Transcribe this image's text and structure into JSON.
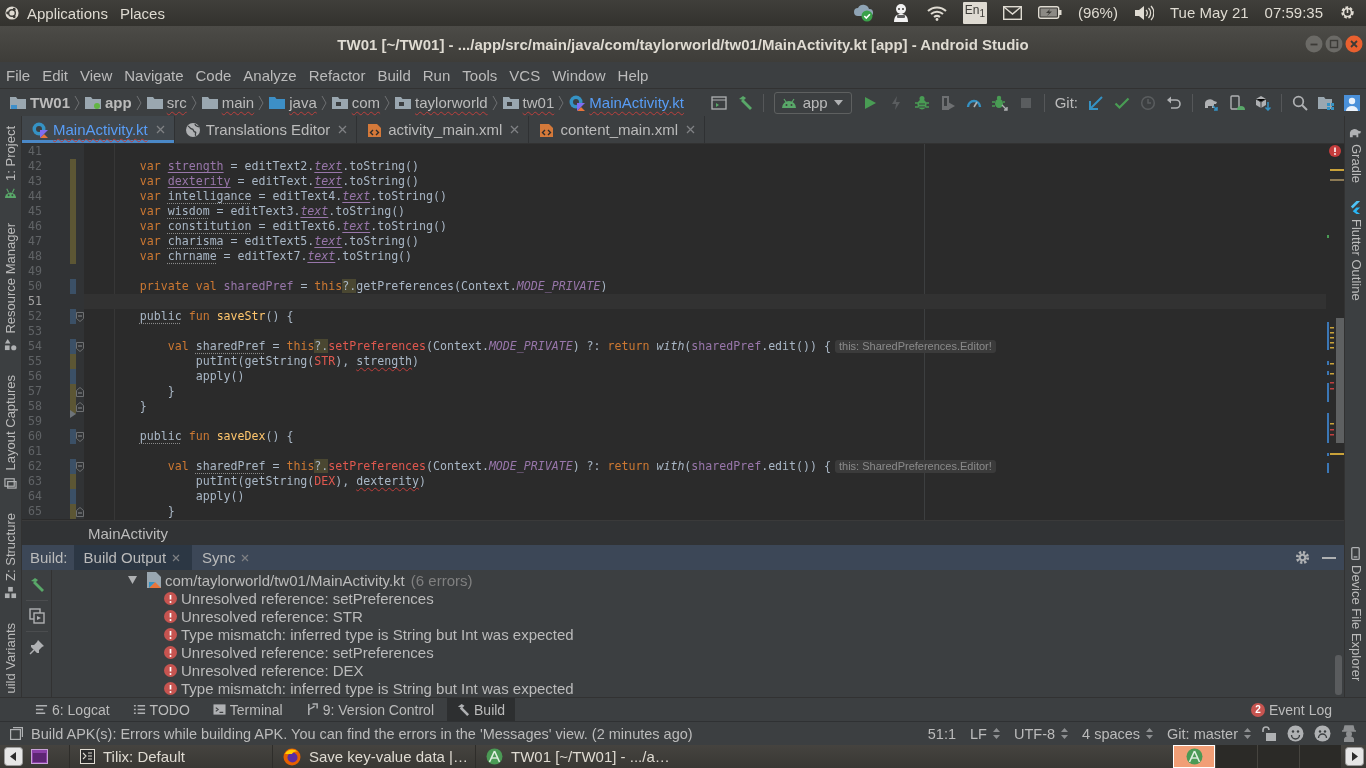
{
  "top_panel": {
    "menus": [
      "Applications",
      "Places"
    ],
    "keyboard_layout": "En$_{1}$",
    "battery": "(96%)",
    "date": "Tue May 21",
    "time": "07:59:35"
  },
  "window": {
    "title": "TW01 [~/TW01] - .../app/src/main/java/com/taylorworld/tw01/MainActivity.kt [app] - Android Studio"
  },
  "menu_bar": [
    "File",
    "Edit",
    "View",
    "Navigate",
    "Code",
    "Analyze",
    "Refactor",
    "Build",
    "Run",
    "Tools",
    "VCS",
    "Window",
    "Help"
  ],
  "nav_bar": {
    "breadcrumbs": [
      {
        "label": "TW01",
        "kind": "project",
        "errors": false,
        "modified": false
      },
      {
        "label": "app",
        "kind": "module",
        "errors": false,
        "modified": false
      },
      {
        "label": "src",
        "kind": "folder",
        "errors": true,
        "modified": false
      },
      {
        "label": "main",
        "kind": "folder",
        "errors": true,
        "modified": false
      },
      {
        "label": "java",
        "kind": "source-root",
        "errors": true,
        "modified": false
      },
      {
        "label": "com",
        "kind": "package",
        "errors": true,
        "modified": false
      },
      {
        "label": "taylorworld",
        "kind": "package",
        "errors": true,
        "modified": false
      },
      {
        "label": "tw01",
        "kind": "package",
        "errors": true,
        "modified": false
      },
      {
        "label": "MainActivity.kt",
        "kind": "kotlin-file",
        "errors": true,
        "modified": true
      }
    ],
    "run_config": "app",
    "apply_changes_disabled": true,
    "stop_disabled": true,
    "history_disabled": true,
    "git_label": "Git:"
  },
  "left_tool_strip": [
    {
      "label": "1: Project",
      "kind": "project"
    },
    {
      "label": "Resource Manager",
      "kind": "resources"
    },
    {
      "label": "Layout Captures",
      "kind": "captures"
    },
    {
      "label": "Z: Structure",
      "kind": "structure"
    },
    {
      "label": "uild Variants",
      "kind": "variants"
    }
  ],
  "right_tool_strip": {
    "top": [
      {
        "label": "Gradle",
        "kind": "gradle"
      },
      {
        "label": "Flutter Outline",
        "kind": "flutter"
      }
    ],
    "bottom": [
      {
        "label": "Device File Explorer",
        "kind": "device"
      }
    ]
  },
  "editor_tabs": [
    {
      "label": "MainActivity.kt",
      "kind": "kotlin",
      "selected": true,
      "modified": true,
      "errors": true
    },
    {
      "label": "Translations Editor",
      "kind": "translations",
      "selected": false,
      "modified": false,
      "errors": false
    },
    {
      "label": "activity_main.xml",
      "kind": "xml",
      "selected": false,
      "modified": false,
      "errors": false
    },
    {
      "label": "content_main.xml",
      "kind": "xml",
      "selected": false,
      "modified": false,
      "errors": false
    }
  ],
  "editor": {
    "lines": [
      {
        "number": "41",
        "added": false,
        "modified": false,
        "deleted_below": false,
        "fold_start": false,
        "fold_end": false,
        "current": false
      },
      {
        "number": "42",
        "tokens": [
          {
            "kind": "keyword",
            "text": "var "
          },
          {
            "kind": "mutable",
            "text": "strength"
          },
          {
            "kind": "plain",
            "text": " = editText2."
          },
          {
            "kind": "member",
            "text": "text"
          },
          {
            "kind": "plain",
            "text": ".toString()"
          }
        ],
        "added": true,
        "modified": false,
        "deleted_below": false,
        "fold_start": false,
        "fold_end": false,
        "current": false
      },
      {
        "number": "43",
        "tokens": [
          {
            "kind": "keyword",
            "text": "var "
          },
          {
            "kind": "mutable",
            "text": "dexterity"
          },
          {
            "kind": "plain",
            "text": " = editText."
          },
          {
            "kind": "member",
            "text": "text"
          },
          {
            "kind": "plain",
            "text": ".toString()"
          }
        ],
        "added": true,
        "modified": false,
        "deleted_below": false,
        "fold_start": false,
        "fold_end": false,
        "current": false
      },
      {
        "number": "44",
        "tokens": [
          {
            "kind": "keyword",
            "text": "var "
          },
          {
            "kind": "unused",
            "text": "intelligance"
          },
          {
            "kind": "plain",
            "text": " = editText4."
          },
          {
            "kind": "member",
            "text": "text"
          },
          {
            "kind": "plain",
            "text": ".toString()"
          }
        ],
        "added": true,
        "modified": false,
        "deleted_below": false,
        "fold_start": false,
        "fold_end": false,
        "current": false
      },
      {
        "number": "45",
        "tokens": [
          {
            "kind": "keyword",
            "text": "var "
          },
          {
            "kind": "unused",
            "text": "wisdom"
          },
          {
            "kind": "plain",
            "text": " = editText3."
          },
          {
            "kind": "member",
            "text": "text"
          },
          {
            "kind": "plain",
            "text": ".toString()"
          }
        ],
        "added": true,
        "modified": false,
        "deleted_below": false,
        "fold_start": false,
        "fold_end": false,
        "current": false
      },
      {
        "number": "46",
        "tokens": [
          {
            "kind": "keyword",
            "text": "var "
          },
          {
            "kind": "unused",
            "text": "constitution"
          },
          {
            "kind": "plain",
            "text": " = editText6."
          },
          {
            "kind": "member",
            "text": "text"
          },
          {
            "kind": "plain",
            "text": ".toString()"
          }
        ],
        "added": true,
        "modified": false,
        "deleted_below": false,
        "fold_start": false,
        "fold_end": false,
        "current": false
      },
      {
        "number": "47",
        "tokens": [
          {
            "kind": "keyword",
            "text": "var "
          },
          {
            "kind": "unused",
            "text": "charisma"
          },
          {
            "kind": "plain",
            "text": " = editText5."
          },
          {
            "kind": "member",
            "text": "text"
          },
          {
            "kind": "plain",
            "text": ".toString()"
          }
        ],
        "added": true,
        "modified": false,
        "deleted_below": false,
        "fold_start": false,
        "fold_end": false,
        "current": false
      },
      {
        "number": "48",
        "tokens": [
          {
            "kind": "keyword",
            "text": "var "
          },
          {
            "kind": "unused",
            "text": "chrname"
          },
          {
            "kind": "plain",
            "text": " = editText7."
          },
          {
            "kind": "member",
            "text": "text"
          },
          {
            "kind": "plain",
            "text": ".toString()"
          }
        ],
        "added": true,
        "modified": false,
        "deleted_below": false,
        "fold_start": false,
        "fold_end": false,
        "current": false
      },
      {
        "number": "49",
        "added": false,
        "modified": false,
        "deleted_below": false,
        "fold_start": false,
        "fold_end": false,
        "current": false
      },
      {
        "number": "50",
        "tokens": [
          {
            "kind": "keyword",
            "text": "private val "
          },
          {
            "kind": "property",
            "text": "sharedPref"
          },
          {
            "kind": "plain",
            "text": " = "
          },
          {
            "kind": "keyword",
            "text": "this"
          },
          {
            "kind": "nullsafe",
            "text": "?."
          },
          {
            "kind": "plain",
            "text": "getPreferences(Context."
          },
          {
            "kind": "constant",
            "text": "MODE_PRIVATE"
          },
          {
            "kind": "plain",
            "text": ")"
          }
        ],
        "added": false,
        "modified": true,
        "deleted_below": false,
        "fold_start": false,
        "fold_end": false,
        "current": false
      },
      {
        "number": "51",
        "added": false,
        "modified": false,
        "deleted_below": false,
        "fold_start": false,
        "fold_end": false,
        "current": true
      },
      {
        "number": "52",
        "tokens": [
          {
            "kind": "unused",
            "text": "public"
          },
          {
            "kind": "keyword",
            "text": " fun "
          },
          {
            "kind": "function",
            "text": "saveStr"
          },
          {
            "kind": "plain",
            "text": "() {"
          }
        ],
        "added": false,
        "modified": true,
        "deleted_below": false,
        "fold_start": true,
        "fold_end": false,
        "current": false,
        "children": [
          {
            "number": "53",
            "added": false,
            "modified": false,
            "deleted_below": false,
            "fold_start": false,
            "fold_end": false,
            "current": false
          },
          {
            "number": "54",
            "tokens": [
              {
                "kind": "keyword",
                "text": "val "
              },
              {
                "kind": "unused",
                "text": "sharedPref"
              },
              {
                "kind": "plain",
                "text": " = "
              },
              {
                "kind": "keyword",
                "text": "this"
              },
              {
                "kind": "nullsafe",
                "text": "?."
              },
              {
                "kind": "unresolved",
                "text": "setPreferences"
              },
              {
                "kind": "plain",
                "text": "(Context."
              },
              {
                "kind": "constant",
                "text": "MODE_PRIVATE"
              },
              {
                "kind": "plain",
                "text": ") ?: "
              },
              {
                "kind": "keyword",
                "text": "return "
              },
              {
                "kind": "scope",
                "text": "with"
              },
              {
                "kind": "plain",
                "text": "("
              },
              {
                "kind": "property",
                "text": "sharedPref"
              },
              {
                "kind": "plain",
                "text": ".edit()) {"
              }
            ],
            "hint": "this: SharedPreferences.Editor!",
            "added": false,
            "modified": true,
            "deleted_below": false,
            "fold_start": true,
            "fold_end": false,
            "current": false,
            "children": [
              {
                "number": "55",
                "tokens": [
                  {
                    "kind": "plain",
                    "text": "putInt(getString("
                  },
                  {
                    "kind": "unresolved",
                    "text": "STR"
                  },
                  {
                    "kind": "plain",
                    "text": "), "
                  },
                  {
                    "kind": "mismatch",
                    "text": "strength"
                  },
                  {
                    "kind": "plain",
                    "text": ")"
                  }
                ],
                "added": true,
                "modified": false,
                "deleted_below": false,
                "fold_start": false,
                "fold_end": false,
                "current": false
              },
              {
                "number": "56",
                "tokens": [
                  {
                    "kind": "plain",
                    "text": "apply()"
                  }
                ],
                "added": false,
                "modified": true,
                "deleted_below": false,
                "fold_start": false,
                "fold_end": false,
                "current": false
              }
            ]
          },
          {
            "number": "57",
            "tokens": [
              {
                "kind": "plain",
                "text": "}"
              }
            ],
            "added": true,
            "modified": false,
            "deleted_below": false,
            "fold_start": false,
            "fold_end": true,
            "current": false
          }
        ]
      },
      {
        "number": "58",
        "tokens": [
          {
            "kind": "plain",
            "text": "}"
          }
        ],
        "added": true,
        "modified": false,
        "deleted_below": true,
        "fold_start": false,
        "fold_end": true,
        "current": false
      },
      {
        "number": "59",
        "added": false,
        "modified": false,
        "deleted_below": false,
        "fold_start": false,
        "fold_end": false,
        "current": false
      },
      {
        "number": "60",
        "tokens": [
          {
            "kind": "unused",
            "text": "public"
          },
          {
            "kind": "keyword",
            "text": " fun "
          },
          {
            "kind": "function",
            "text": "saveDex"
          },
          {
            "kind": "plain",
            "text": "() {"
          }
        ],
        "added": false,
        "modified": true,
        "deleted_below": false,
        "fold_start": true,
        "fold_end": false,
        "current": false,
        "children": [
          {
            "number": "61",
            "added": false,
            "modified": false,
            "deleted_below": false,
            "fold_start": false,
            "fold_end": false,
            "current": false
          },
          {
            "number": "62",
            "tokens": [
              {
                "kind": "keyword",
                "text": "val "
              },
              {
                "kind": "unused",
                "text": "sharedPref"
              },
              {
                "kind": "plain",
                "text": " = "
              },
              {
                "kind": "keyword",
                "text": "this"
              },
              {
                "kind": "nullsafe",
                "text": "?."
              },
              {
                "kind": "unresolved",
                "text": "setPreferences"
              },
              {
                "kind": "plain",
                "text": "(Context."
              },
              {
                "kind": "constant",
                "text": "MODE_PRIVATE"
              },
              {
                "kind": "plain",
                "text": ") ?: "
              },
              {
                "kind": "keyword",
                "text": "return "
              },
              {
                "kind": "scope",
                "text": "with"
              },
              {
                "kind": "plain",
                "text": "("
              },
              {
                "kind": "property",
                "text": "sharedPref"
              },
              {
                "kind": "plain",
                "text": ".edit()) {"
              }
            ],
            "hint": "this: SharedPreferences.Editor!",
            "added": false,
            "modified": true,
            "deleted_below": false,
            "fold_start": true,
            "fold_end": false,
            "current": false,
            "children": [
              {
                "number": "63",
                "tokens": [
                  {
                    "kind": "plain",
                    "text": "putInt(getString("
                  },
                  {
                    "kind": "unresolved",
                    "text": "DEX"
                  },
                  {
                    "kind": "plain",
                    "text": "), "
                  },
                  {
                    "kind": "mismatch",
                    "text": "dexterity"
                  },
                  {
                    "kind": "plain",
                    "text": ")"
                  }
                ],
                "added": true,
                "modified": false,
                "deleted_below": false,
                "fold_start": false,
                "fold_end": false,
                "current": false
              },
              {
                "number": "64",
                "tokens": [
                  {
                    "kind": "plain",
                    "text": "apply()"
                  }
                ],
                "added": false,
                "modified": true,
                "deleted_below": false,
                "fold_start": false,
                "fold_end": false,
                "current": false
              }
            ]
          },
          {
            "number": "65",
            "tokens": [
              {
                "kind": "plain",
                "text": "}"
              }
            ],
            "added": true,
            "modified": false,
            "deleted_below": false,
            "fold_start": false,
            "fold_end": true,
            "current": false
          }
        ]
      }
    ],
    "breadcrumb": "MainActivity"
  },
  "build_panel": {
    "label": "Build:",
    "tabs": [
      {
        "label": "Build Output",
        "selected": true
      },
      {
        "label": "Sync",
        "selected": false
      }
    ],
    "tree": [
      {
        "label": "com/taylorworld/tw01/MainActivity.kt",
        "count": "(6 errors)",
        "expanded": true,
        "children": [
          {
            "label": "Unresolved reference: setPreferences",
            "kind": "error"
          },
          {
            "label": "Unresolved reference: STR",
            "kind": "error"
          },
          {
            "label": "Type mismatch: inferred type is String but Int was expected",
            "kind": "error"
          },
          {
            "label": "Unresolved reference: setPreferences",
            "kind": "error"
          },
          {
            "label": "Unresolved reference: DEX",
            "kind": "error"
          },
          {
            "label": "Type mismatch: inferred type is String but Int was expected",
            "kind": "error"
          }
        ]
      }
    ]
  },
  "tool_window_bar": {
    "items": [
      {
        "label": "6: Logcat",
        "kind": "logcat",
        "selected": false
      },
      {
        "label": "TODO",
        "kind": "todo",
        "selected": false
      },
      {
        "label": "Terminal",
        "kind": "terminal",
        "selected": false
      },
      {
        "label": "9: Version Control",
        "kind": "vcs",
        "selected": false
      },
      {
        "label": "Build",
        "kind": "build",
        "selected": true
      }
    ],
    "event_log": {
      "label": "Event Log",
      "badge": "2"
    }
  },
  "status_bar": {
    "message": "Build APK(s): Errors while building APK. You can find the errors in the 'Messages' view. (2 minutes ago)",
    "items": [
      {
        "label": "51:1",
        "dropdown": false
      },
      {
        "label": "LF",
        "dropdown": true
      },
      {
        "label": "UTF-8",
        "dropdown": true
      },
      {
        "label": "4 spaces",
        "dropdown": true
      },
      {
        "label": "Git: master",
        "dropdown": true
      }
    ]
  },
  "taskbar": {
    "windows": [
      {
        "label": "Tilix: Default",
        "kind": "terminal"
      },
      {
        "label": "Save key-value data |…",
        "kind": "browser"
      },
      {
        "label": "TW01 [~/TW01] - .../a…",
        "kind": "android-studio"
      }
    ],
    "workspaces": [
      {
        "selected": true
      },
      {
        "selected": false
      },
      {
        "selected": false
      },
      {
        "selected": false
      }
    ]
  }
}
